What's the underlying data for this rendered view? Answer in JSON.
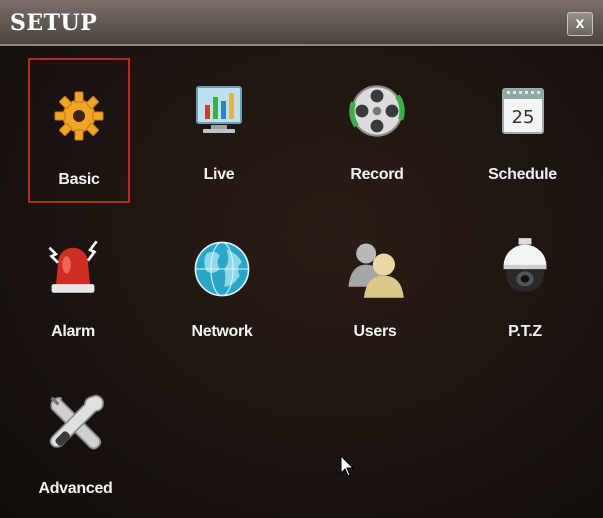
{
  "window": {
    "title": "SETUP",
    "close_glyph": "x"
  },
  "items": [
    {
      "label": "Basic",
      "icon": "gear-icon",
      "selected": true
    },
    {
      "label": "Live",
      "icon": "monitor-chart-icon",
      "selected": false
    },
    {
      "label": "Record",
      "icon": "film-reel-icon",
      "selected": false
    },
    {
      "label": "Schedule",
      "icon": "calendar-icon",
      "selected": false,
      "icon_text": "25"
    },
    {
      "label": "Alarm",
      "icon": "siren-icon",
      "selected": false
    },
    {
      "label": "Network",
      "icon": "globe-icon",
      "selected": false
    },
    {
      "label": "Users",
      "icon": "users-icon",
      "selected": false
    },
    {
      "label": "P.T.Z",
      "icon": "dome-camera-icon",
      "selected": false
    },
    {
      "label": "Advanced",
      "icon": "tools-icon",
      "selected": false
    }
  ],
  "colors": {
    "selection_border": "#b62b1f",
    "background": "#1a1310",
    "titlebar": "#6a605b"
  }
}
